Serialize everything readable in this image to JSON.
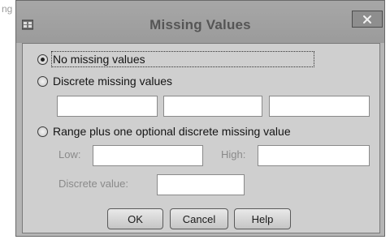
{
  "dialog": {
    "title": "Missing Values",
    "close_glyph": "×"
  },
  "options": {
    "no_missing": "No missing values",
    "discrete": "Discrete missing values",
    "range": "Range plus one optional discrete missing value"
  },
  "range_fields": {
    "low_label": "Low:",
    "high_label": "High:",
    "discrete_value_label": "Discrete value:"
  },
  "buttons": {
    "ok": "OK",
    "cancel": "Cancel",
    "help": "Help"
  },
  "state": {
    "selected_option": "no_missing"
  }
}
